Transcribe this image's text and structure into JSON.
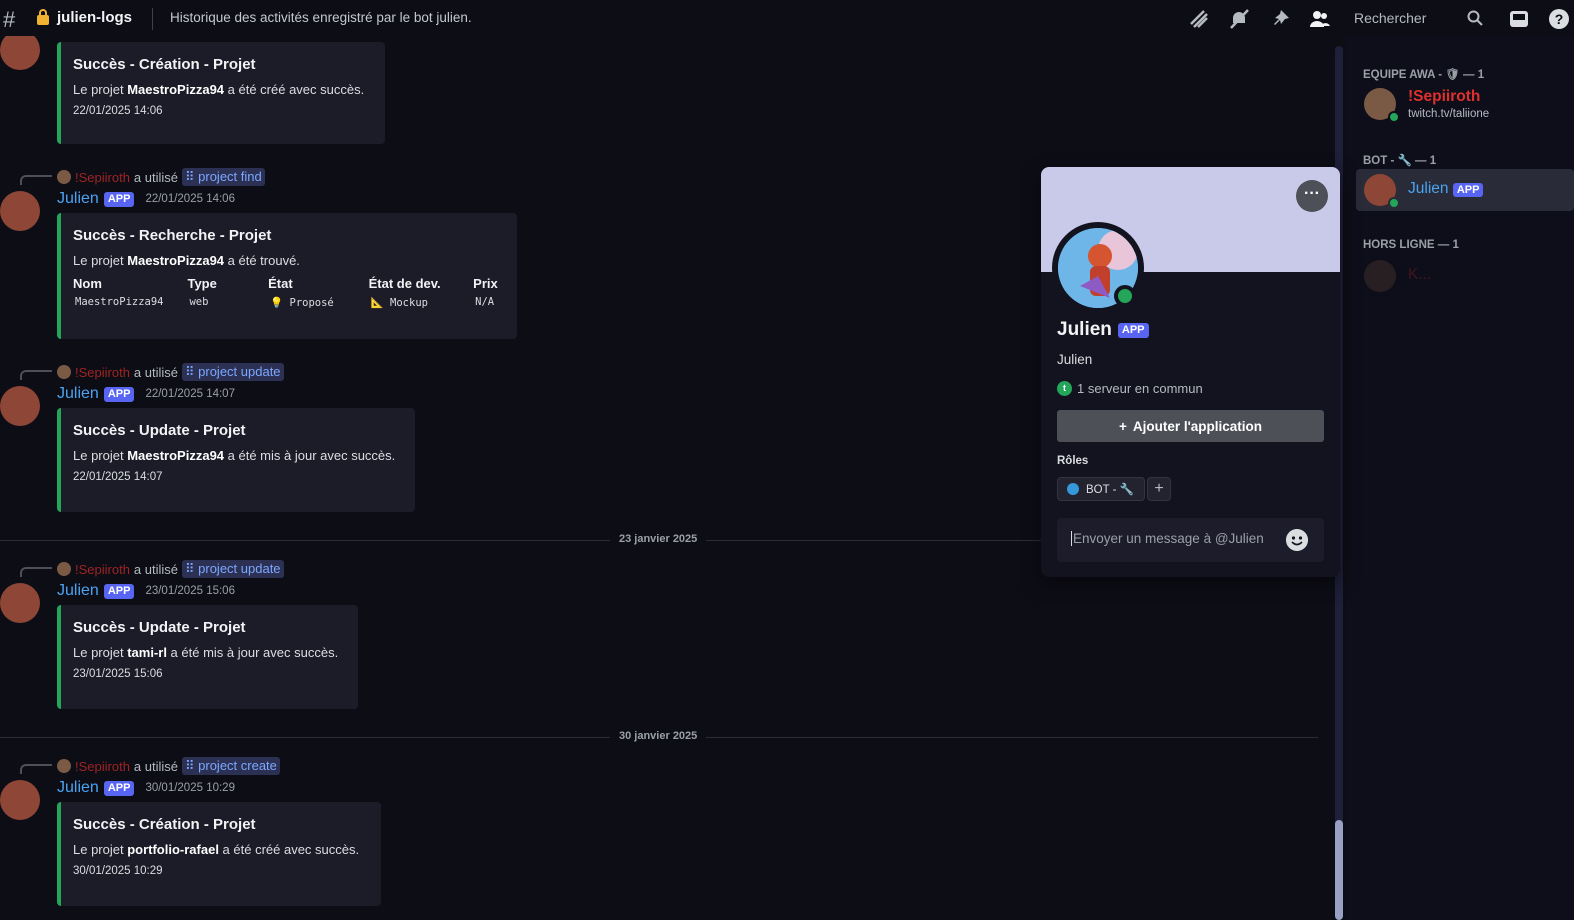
{
  "header": {
    "channel_name": "julien-logs",
    "topic": "Historique des activités enregistré par le bot julien.",
    "search_placeholder": "Rechercher"
  },
  "messages": [
    {
      "embed": {
        "title": "Succès - Création - Projet",
        "desc_pre": "Le projet ",
        "desc_bold": "MaestroPizza94",
        "desc_post": " a été créé avec succès.",
        "footer": "22/01/2025 14:06"
      }
    },
    {
      "reply": {
        "user": "!Sepiiroth",
        "used": "a utilisé",
        "command": "project find"
      },
      "author": "Julien",
      "badge": "APP",
      "time": "22/01/2025 14:06",
      "embed": {
        "title": "Succès - Recherche - Projet",
        "desc_pre": "Le projet ",
        "desc_bold": "MaestroPizza94",
        "desc_post": " a été trouvé.",
        "fields": [
          {
            "name": "Nom",
            "value": "MaestroPizza94"
          },
          {
            "name": "Type",
            "value": "web"
          },
          {
            "name": "État",
            "value": "💡 Proposé"
          },
          {
            "name": "État de dev.",
            "value": "📐 Mockup"
          },
          {
            "name": "Prix",
            "value": "N/A"
          }
        ]
      }
    },
    {
      "reply": {
        "user": "!Sepiiroth",
        "used": "a utilisé",
        "command": "project update"
      },
      "author": "Julien",
      "badge": "APP",
      "time": "22/01/2025 14:07",
      "embed": {
        "title": "Succès - Update - Projet",
        "desc_pre": "Le projet ",
        "desc_bold": "MaestroPizza94",
        "desc_post": " a été mis à jour avec succès.",
        "footer": "22/01/2025 14:07"
      }
    },
    {
      "reply": {
        "user": "!Sepiiroth",
        "used": "a utilisé",
        "command": "project update"
      },
      "author": "Julien",
      "badge": "APP",
      "time": "23/01/2025 15:06",
      "embed": {
        "title": "Succès - Update - Projet",
        "desc_pre": "Le projet ",
        "desc_bold": "tami-rl",
        "desc_post": " a été mis à jour avec succès.",
        "footer": "23/01/2025 15:06"
      }
    },
    {
      "reply": {
        "user": "!Sepiiroth",
        "used": "a utilisé",
        "command": "project create"
      },
      "author": "Julien",
      "badge": "APP",
      "time": "30/01/2025 10:29",
      "embed": {
        "title": "Succès - Création - Projet",
        "desc_pre": "Le projet ",
        "desc_bold": "portfolio-rafael",
        "desc_post": " a été créé avec succès.",
        "footer": "30/01/2025 10:29"
      }
    }
  ],
  "date_separators": [
    "23 janvier 2025",
    "30 janvier 2025"
  ],
  "members": {
    "group1": "EQUIPE AWA - 🛡 — 1",
    "member1_name": "!Sepiiroth",
    "member1_status": "twitch.tv/taliione",
    "group2": "BOT - 🔧 — 1",
    "member2_name": "Julien",
    "member2_badge": "APP",
    "group3": "HORS LIGNE — 1",
    "member3_name": "K..."
  },
  "profile": {
    "display_name": "Julien",
    "badge": "APP",
    "username": "Julien",
    "common_servers": "1 serveur en commun",
    "add_app_label": "Ajouter l'application",
    "roles_heading": "Rôles",
    "role_name": "BOT - 🔧",
    "message_placeholder": "Envoyer un message à @Julien",
    "more_label": "···"
  },
  "colors": {
    "accent": "#5865f2",
    "success": "#23a55a",
    "link": "#4aa3f0",
    "sepiiroth": "#e0302e"
  }
}
